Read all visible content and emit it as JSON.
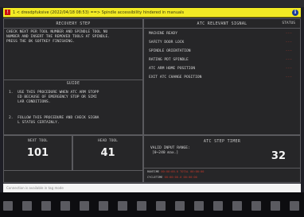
{
  "alarm": {
    "warning_icon": "warning-icon",
    "text": "1 < dresdpfuksive (2022/04/18 08:53) ==> Spindle accessibility hindered in manuals",
    "info_icon": "info-icon",
    "info_glyph": "i"
  },
  "recovery": {
    "title": "RECOVERY STEP",
    "body": "CHECK NEXT PER TOOL NUMBER AND SPINDLE TOOL NU\nNUMBER AND INSERT THE REMOVED TOOLS AT SPINDLE.\nPRESS THE OK SOFTKEY FINISHING."
  },
  "guide": {
    "title": "GUIDE",
    "items": [
      "1.  USE THIS PROCEDURE WHEN ATC ARM STOPP\n    ED BECAUSE OF EMERGENCY STOP OR SIMI\n    LAR CONDITIONS.",
      "2.  FOLLOW THIS PROCEDURE AND CHECK SIGNA\n    L STATUS CERTAINLY."
    ]
  },
  "signals": {
    "title": "ATC RELEVANT SIGNAL",
    "status_header": "STATUS",
    "rows": [
      {
        "label": "MACHINE READY",
        "status": "---"
      },
      {
        "label": "SAFETY DOOR LOCK",
        "status": "---"
      },
      {
        "label": "SPINDLE ORIENTATION",
        "status": "---"
      },
      {
        "label": "RATING PDT SPINDLE",
        "status": "---"
      },
      {
        "label": "ATC ARM HOME POSITION",
        "status": "---"
      },
      {
        "label": "EXIT ATC CHANGE POSITION",
        "status": "---"
      }
    ]
  },
  "tools": {
    "next_label": "NEXT TOOL",
    "next_value": "101",
    "head_label": "HEAD TOOL",
    "head_value": "41"
  },
  "atc_step": {
    "title": "ATC STEP TIMER",
    "range_label": "VALID INPUT RANGE:",
    "range_value": "[0~240 max.]",
    "value": "32"
  },
  "timers": {
    "line1_label": "RUNTIME",
    "line1_value": "00:00:00.0  TOTAL  00:00:00",
    "line2_label": "CYCLETIME",
    "line2_value": "00:00:00.0  00:00:00"
  },
  "footer": {
    "text": "Connection is available in tag mode"
  }
}
